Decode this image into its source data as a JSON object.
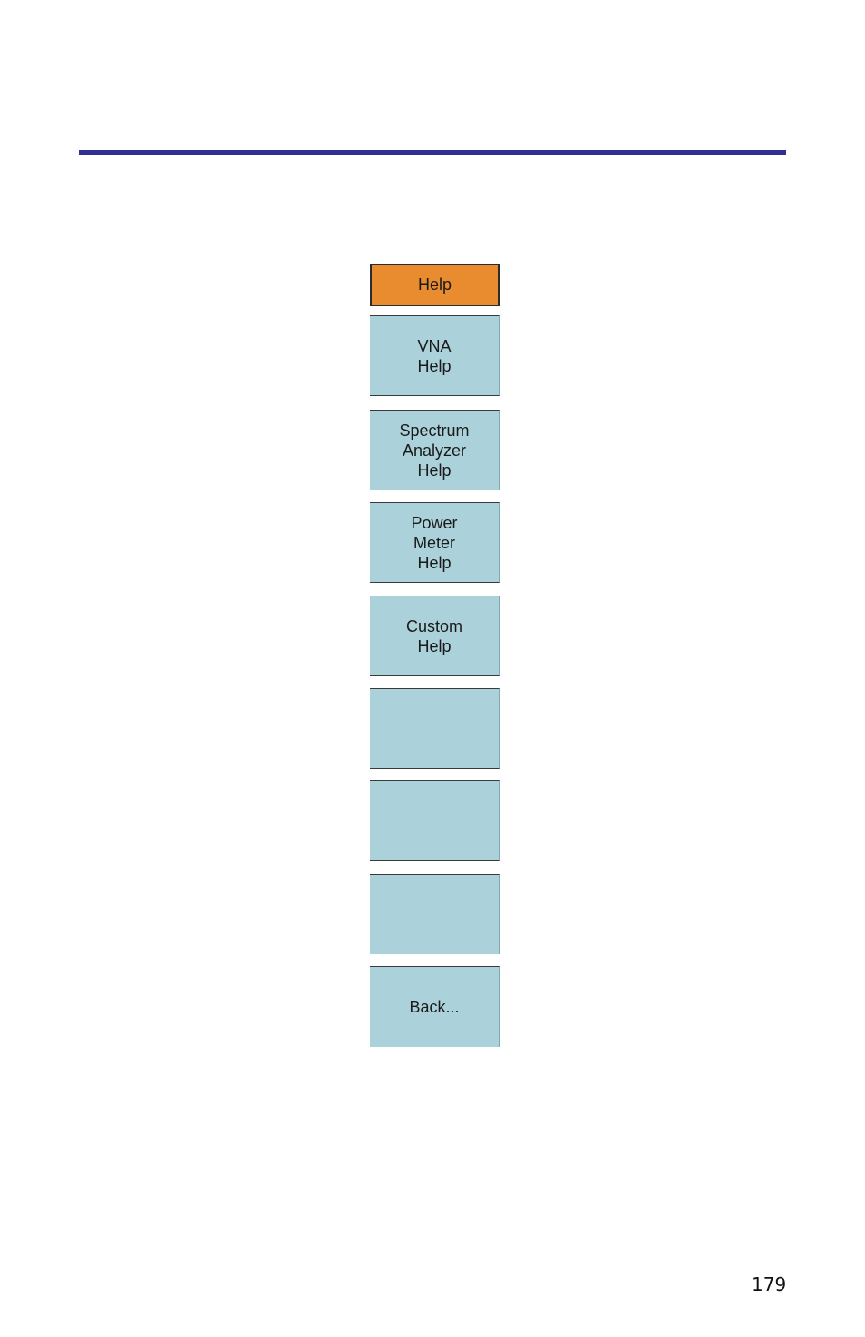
{
  "colors": {
    "rule": "#2e3192",
    "menu_title_bg": "#e98c2f",
    "key_bg": "#abd1db"
  },
  "menu": {
    "title": "Help",
    "keys": [
      {
        "label": "VNA\nHelp"
      },
      {
        "label": "Spectrum\nAnalyzer\nHelp"
      },
      {
        "label": "Power\nMeter\nHelp"
      },
      {
        "label": "Custom\nHelp"
      },
      {
        "label": ""
      },
      {
        "label": ""
      },
      {
        "label": ""
      },
      {
        "label": "Back..."
      }
    ]
  },
  "footer": {
    "page_number": "179"
  }
}
